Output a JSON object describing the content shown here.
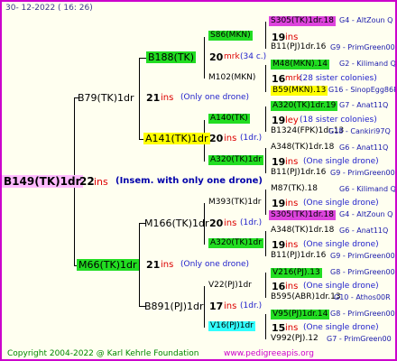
{
  "date": "30-  12-2022  (  16:  26)",
  "root": {
    "name": "B149(TK)1dr",
    "num": "22",
    "ins": "ins",
    "note": "(Insem. with only one drone)"
  },
  "p1": {
    "name": "B79(TK)1dr",
    "num": "21",
    "ins": "ins",
    "note": "(Only one drone)"
  },
  "p2": {
    "name": "M66(TK)1dr",
    "num": "21",
    "ins": "ins",
    "note": "(Only one drone)"
  },
  "g1": {
    "name": "B188(TK)",
    "num": "20",
    "ins": "mrk",
    "note": "(34 c.)"
  },
  "g2": {
    "name": "A141(TK)1dr",
    "num": "20",
    "ins": "ins",
    "note": "(1dr.)"
  },
  "g3": {
    "name": "M166(TK)1dr",
    "num": "20",
    "ins": "ins",
    "note": "(1dr.)"
  },
  "g4": {
    "name": "B891(PJ)1dr",
    "num": "17",
    "ins": "ins",
    "note": "(1dr.)"
  },
  "gg": [
    {
      "name": "S86(MKN)",
      "num": "19",
      "ins": "ins",
      "note": ""
    },
    {
      "name": "M102(MKN)",
      "num": "16",
      "ins": "mrk",
      "note": "(28 sister colonies)"
    },
    {
      "name": "A140(TK)",
      "num": "19",
      "ins": "ley",
      "note": "(18 sister colonies)"
    },
    {
      "name": "A320(TK)1dr",
      "num": "19",
      "ins": "ins",
      "note": "(One single drone)"
    },
    {
      "name": "M393(TK)1dr",
      "num": "19",
      "ins": "ins",
      "note": "(One single drone)"
    },
    {
      "name": "A320(TK)1dr",
      "num": "19",
      "ins": "ins",
      "note": "(One single drone)"
    },
    {
      "name": "V22(PJ)1dr",
      "num": "16",
      "ins": "ins",
      "note": "(One single drone)"
    },
    {
      "name": "V16(PJ)1dr",
      "num": "15",
      "ins": "ins",
      "note": "(One single drone)"
    }
  ],
  "ancestors": [
    {
      "name": "S305(TK)1dr.18",
      "tag": "G4 - AltZoun Q"
    },
    {
      "name": "B11(PJ)1dr.16",
      "tag": "G9 - PrimGreen00"
    },
    {
      "name": "M48(MKN).14",
      "tag": "G2 - Kilimand Q"
    },
    {
      "name": "B59(MKN).13",
      "tag": "G16 - SinopEgg86R"
    },
    {
      "name": "A320(TK)1dr.19",
      "tag": "G7 - Anat11Q"
    },
    {
      "name": "B1324(FPK)1dr.13",
      "tag": "G18 - Cankiri97Q"
    },
    {
      "name": "A348(TK)1dr.18",
      "tag": "G6 - Anat11Q"
    },
    {
      "name": "B11(PJ)1dr.16",
      "tag": "G9 - PrimGreen00"
    },
    {
      "name": "M87(TK).18",
      "tag": "G6 - Kilimand Q"
    },
    {
      "name": "S305(TK)1dr.18",
      "tag": "G4 - AltZoun Q"
    },
    {
      "name": "A348(TK)1dr.18",
      "tag": "G6 - Anat11Q"
    },
    {
      "name": "B11(PJ)1dr.16",
      "tag": "G9 - PrimGreen00"
    },
    {
      "name": "V216(PJ).13",
      "tag": "G8 - PrimGreen00"
    },
    {
      "name": "B595(ABR)1dr.13",
      "tag": "G10 - Athos00R"
    },
    {
      "name": "V95(PJ)1dr.14",
      "tag": "G8 - PrimGreen00"
    },
    {
      "name": "V992(PJ).12",
      "tag": "G7 - PrimGreen00"
    }
  ],
  "footer": {
    "copyright": "Copyright 2004-2022 @ Karl Kehrle Foundation",
    "url": "www.pedigreeapis.org"
  }
}
